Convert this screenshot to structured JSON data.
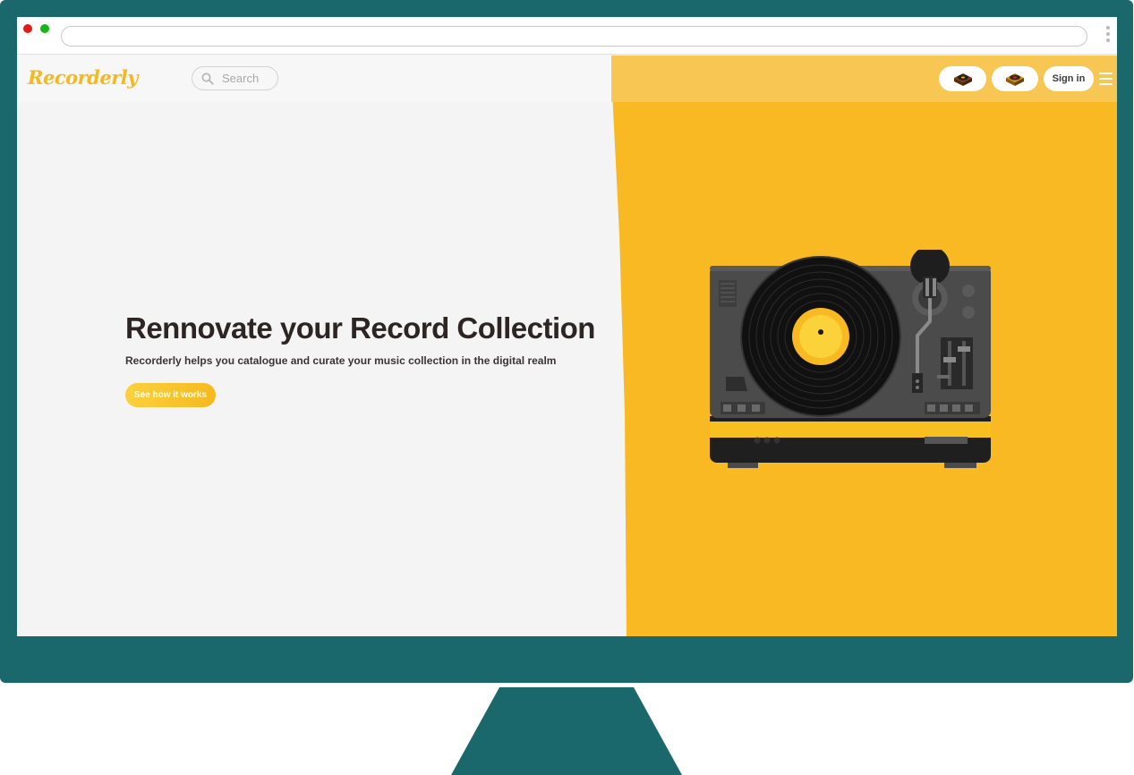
{
  "browser": {
    "url": ""
  },
  "site": {
    "logo": "Recorderly",
    "search": {
      "placeholder": "Search"
    },
    "nav": {
      "sign_in_label": "Sign in",
      "icon_buttons": [
        "turntable-icon",
        "turntable-icon"
      ]
    }
  },
  "hero": {
    "title": "Rennovate your Record Collection",
    "subtitle": "Recorderly helps you catalogue and curate your music collection in the digital realm",
    "cta_label": "See how it works"
  },
  "colors": {
    "brand_yellow": "#f8b922",
    "monitor_teal": "#1b686c",
    "page_background": "#f4f4f4",
    "text_dark": "#2d2524"
  }
}
